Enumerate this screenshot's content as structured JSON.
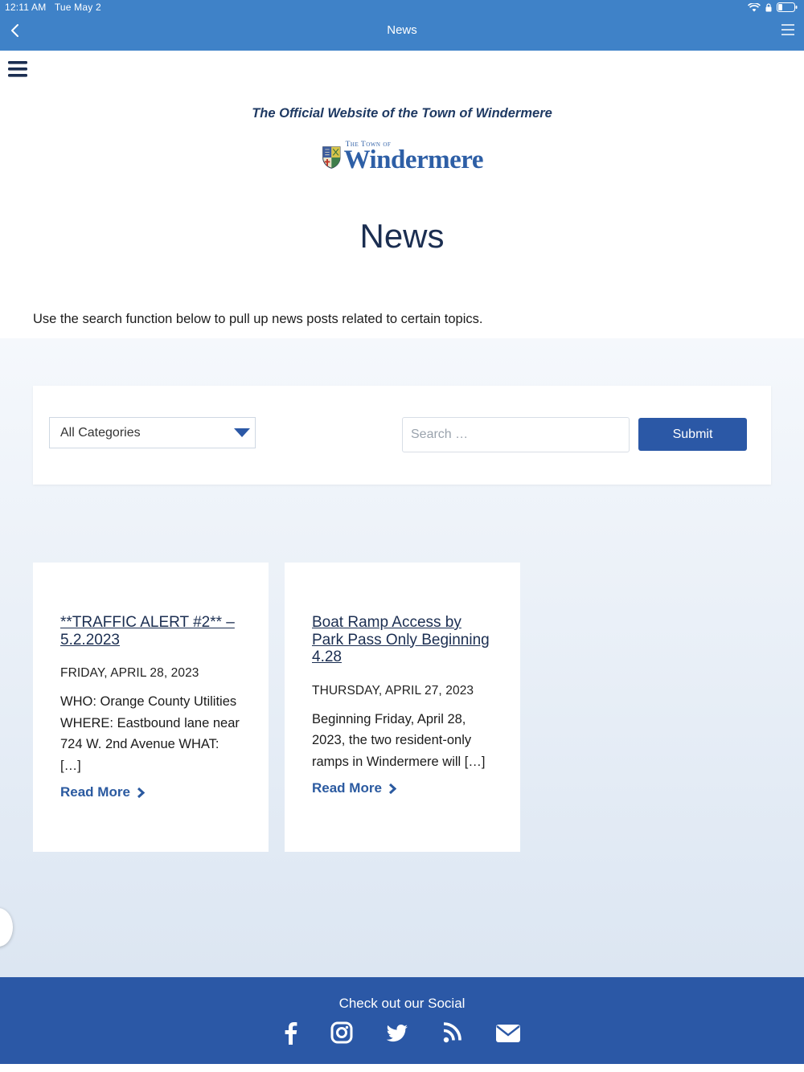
{
  "status_bar": {
    "time": "12:11 AM",
    "date": "Tue May 2"
  },
  "app_nav": {
    "title": "News",
    "back_icon": "chevron-left-icon",
    "menu_icon": "hamburger-icon"
  },
  "site": {
    "tagline": "The Official Website of the Town of Windermere",
    "logo": {
      "small_text": "The Town of",
      "big_text": "Windermere"
    },
    "page_title": "News",
    "intro": "Use the search function below to pull up news posts related to certain topics."
  },
  "filters": {
    "category_selected": "All Categories",
    "search_placeholder": "Search …",
    "submit_label": "Submit"
  },
  "posts": [
    {
      "title": "**TRAFFIC ALERT #2** – 5.2.2023",
      "date": "FRIDAY, APRIL 28, 2023",
      "excerpt": "WHO: Orange County Utilities WHERE: Eastbound lane near 724 W. 2nd Avenue WHAT: […]",
      "read_more": "Read More"
    },
    {
      "title": "Boat Ramp Access by Park Pass Only Beginning 4.28",
      "date": "THURSDAY, APRIL 27, 2023",
      "excerpt": "Beginning Friday, April 28, 2023, the two resident-only ramps in Windermere will […]",
      "read_more": "Read More"
    }
  ],
  "footer": {
    "heading": "Check out our Social",
    "social_icons": [
      "facebook-icon",
      "instagram-icon",
      "twitter-icon",
      "rss-icon",
      "email-icon"
    ]
  },
  "colors": {
    "app_bar": "#3f82c8",
    "brand_blue": "#2b58a6",
    "title_navy": "#1b2e51"
  }
}
